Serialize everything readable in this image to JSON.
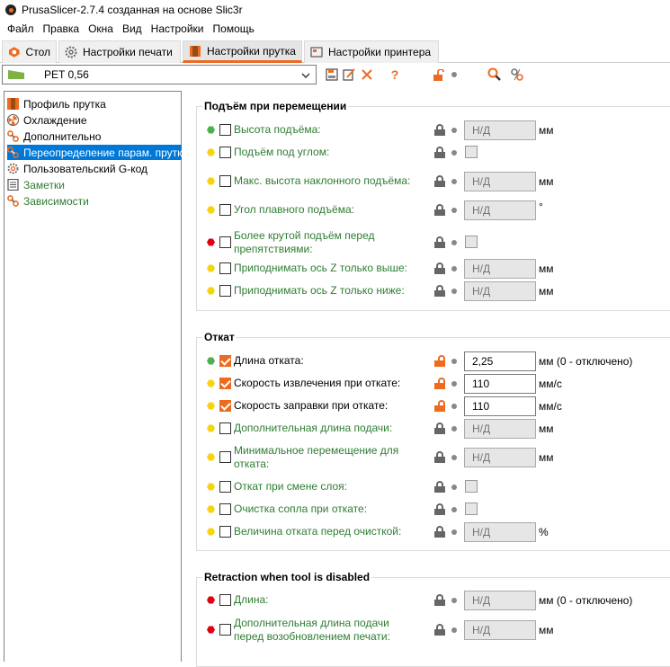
{
  "window": {
    "title": "PrusaSlicer-2.7.4 созданная на основе Slic3r"
  },
  "menu": [
    "Файл",
    "Правка",
    "Окна",
    "Вид",
    "Настройки",
    "Помощь"
  ],
  "tabs": [
    {
      "label": "Стол",
      "icon": "plater-icon"
    },
    {
      "label": "Настройки печати",
      "icon": "cog-icon"
    },
    {
      "label": "Настройки прутка",
      "icon": "spool-icon"
    },
    {
      "label": "Настройки принтера",
      "icon": "printer-icon"
    }
  ],
  "active_tab": 2,
  "preset": {
    "name": "PET 0,56"
  },
  "colors": {
    "accent": "#ed6b21",
    "modified_label": "#2e7d32",
    "selection": "#0078d7"
  },
  "sidebar": {
    "items": [
      {
        "label": "Профиль прутка",
        "icon": "spool-icon"
      },
      {
        "label": "Охлаждение",
        "icon": "fan-icon"
      },
      {
        "label": "Дополнительно",
        "icon": "wrench-icon"
      },
      {
        "label": "Переопределение парам. прутка",
        "icon": "wrench-icon"
      },
      {
        "label": "Пользовательский G-код",
        "icon": "cog-icon"
      },
      {
        "label": "Заметки",
        "icon": "note-icon"
      },
      {
        "label": "Зависимости",
        "icon": "wrench-icon"
      }
    ]
  },
  "groups": [
    {
      "title": "Подъём при перемещении",
      "rows": [
        {
          "label": "Высота подъёма:",
          "value": "Н/Д",
          "unit": "мм"
        },
        {
          "label": "Подъём под углом:"
        },
        {
          "label": "Макс. высота наклонного подъёма:",
          "value": "Н/Д",
          "unit": "мм"
        },
        {
          "label": "Угол плавного подъёма:",
          "value": "Н/Д",
          "unit": "°"
        },
        {
          "label": "Более крутой подъём перед",
          "label2": "препятствиями:"
        },
        {
          "label": "Приподнимать ось Z только выше:",
          "value": "Н/Д",
          "unit": "мм"
        },
        {
          "label": "Приподнимать ось Z только ниже:",
          "value": "Н/Д",
          "unit": "мм"
        }
      ]
    },
    {
      "title": "Откат",
      "rows": [
        {
          "label": "Длина отката:",
          "value": "2,25",
          "unit": "мм (0 - отключено)"
        },
        {
          "label": "Скорость извлечения при откате:",
          "value": "110",
          "unit": "мм/с"
        },
        {
          "label": "Скорость заправки при откате:",
          "value": "110",
          "unit": "мм/с"
        },
        {
          "label": "Дополнительная длина подачи:",
          "value": "Н/Д",
          "unit": "мм"
        },
        {
          "label": "Минимальное перемещение для",
          "label2": "отката:",
          "value": "Н/Д",
          "unit": "мм"
        },
        {
          "label": "Откат при смене слоя:"
        },
        {
          "label": "Очистка сопла при откате:"
        },
        {
          "label": "Величина отката перед очисткой:",
          "value": "Н/Д",
          "unit": "%"
        }
      ]
    },
    {
      "title": "Retraction when tool is disabled",
      "rows": [
        {
          "label": "Длина:",
          "value": "Н/Д",
          "unit": "мм (0 - отключено)"
        },
        {
          "label": "Дополнительная длина подачи",
          "label2": "перед возобновлением печати:",
          "value": "Н/Д",
          "unit": "мм"
        }
      ]
    }
  ]
}
